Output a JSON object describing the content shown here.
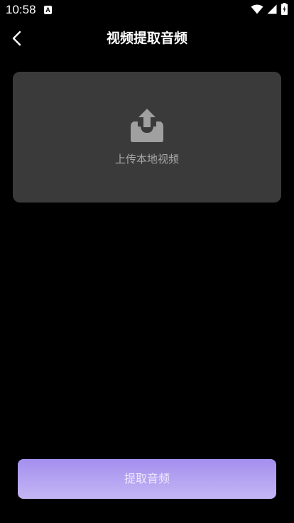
{
  "status_bar": {
    "time": "10:58",
    "notification_badge": "A",
    "icons": [
      "wifi-icon",
      "signal-icon",
      "battery-icon"
    ]
  },
  "header": {
    "back_icon": "chevron-left-icon",
    "title": "视频提取音频"
  },
  "upload": {
    "icon": "upload-tray-icon",
    "label": "上传本地视频"
  },
  "actions": {
    "extract_label": "提取音频"
  },
  "colors": {
    "background": "#000000",
    "card": "#3a3a3a",
    "card_text": "#a8a8a8",
    "button_gradient_top": "#a48fef",
    "button_gradient_bottom": "#c4b6f4"
  }
}
